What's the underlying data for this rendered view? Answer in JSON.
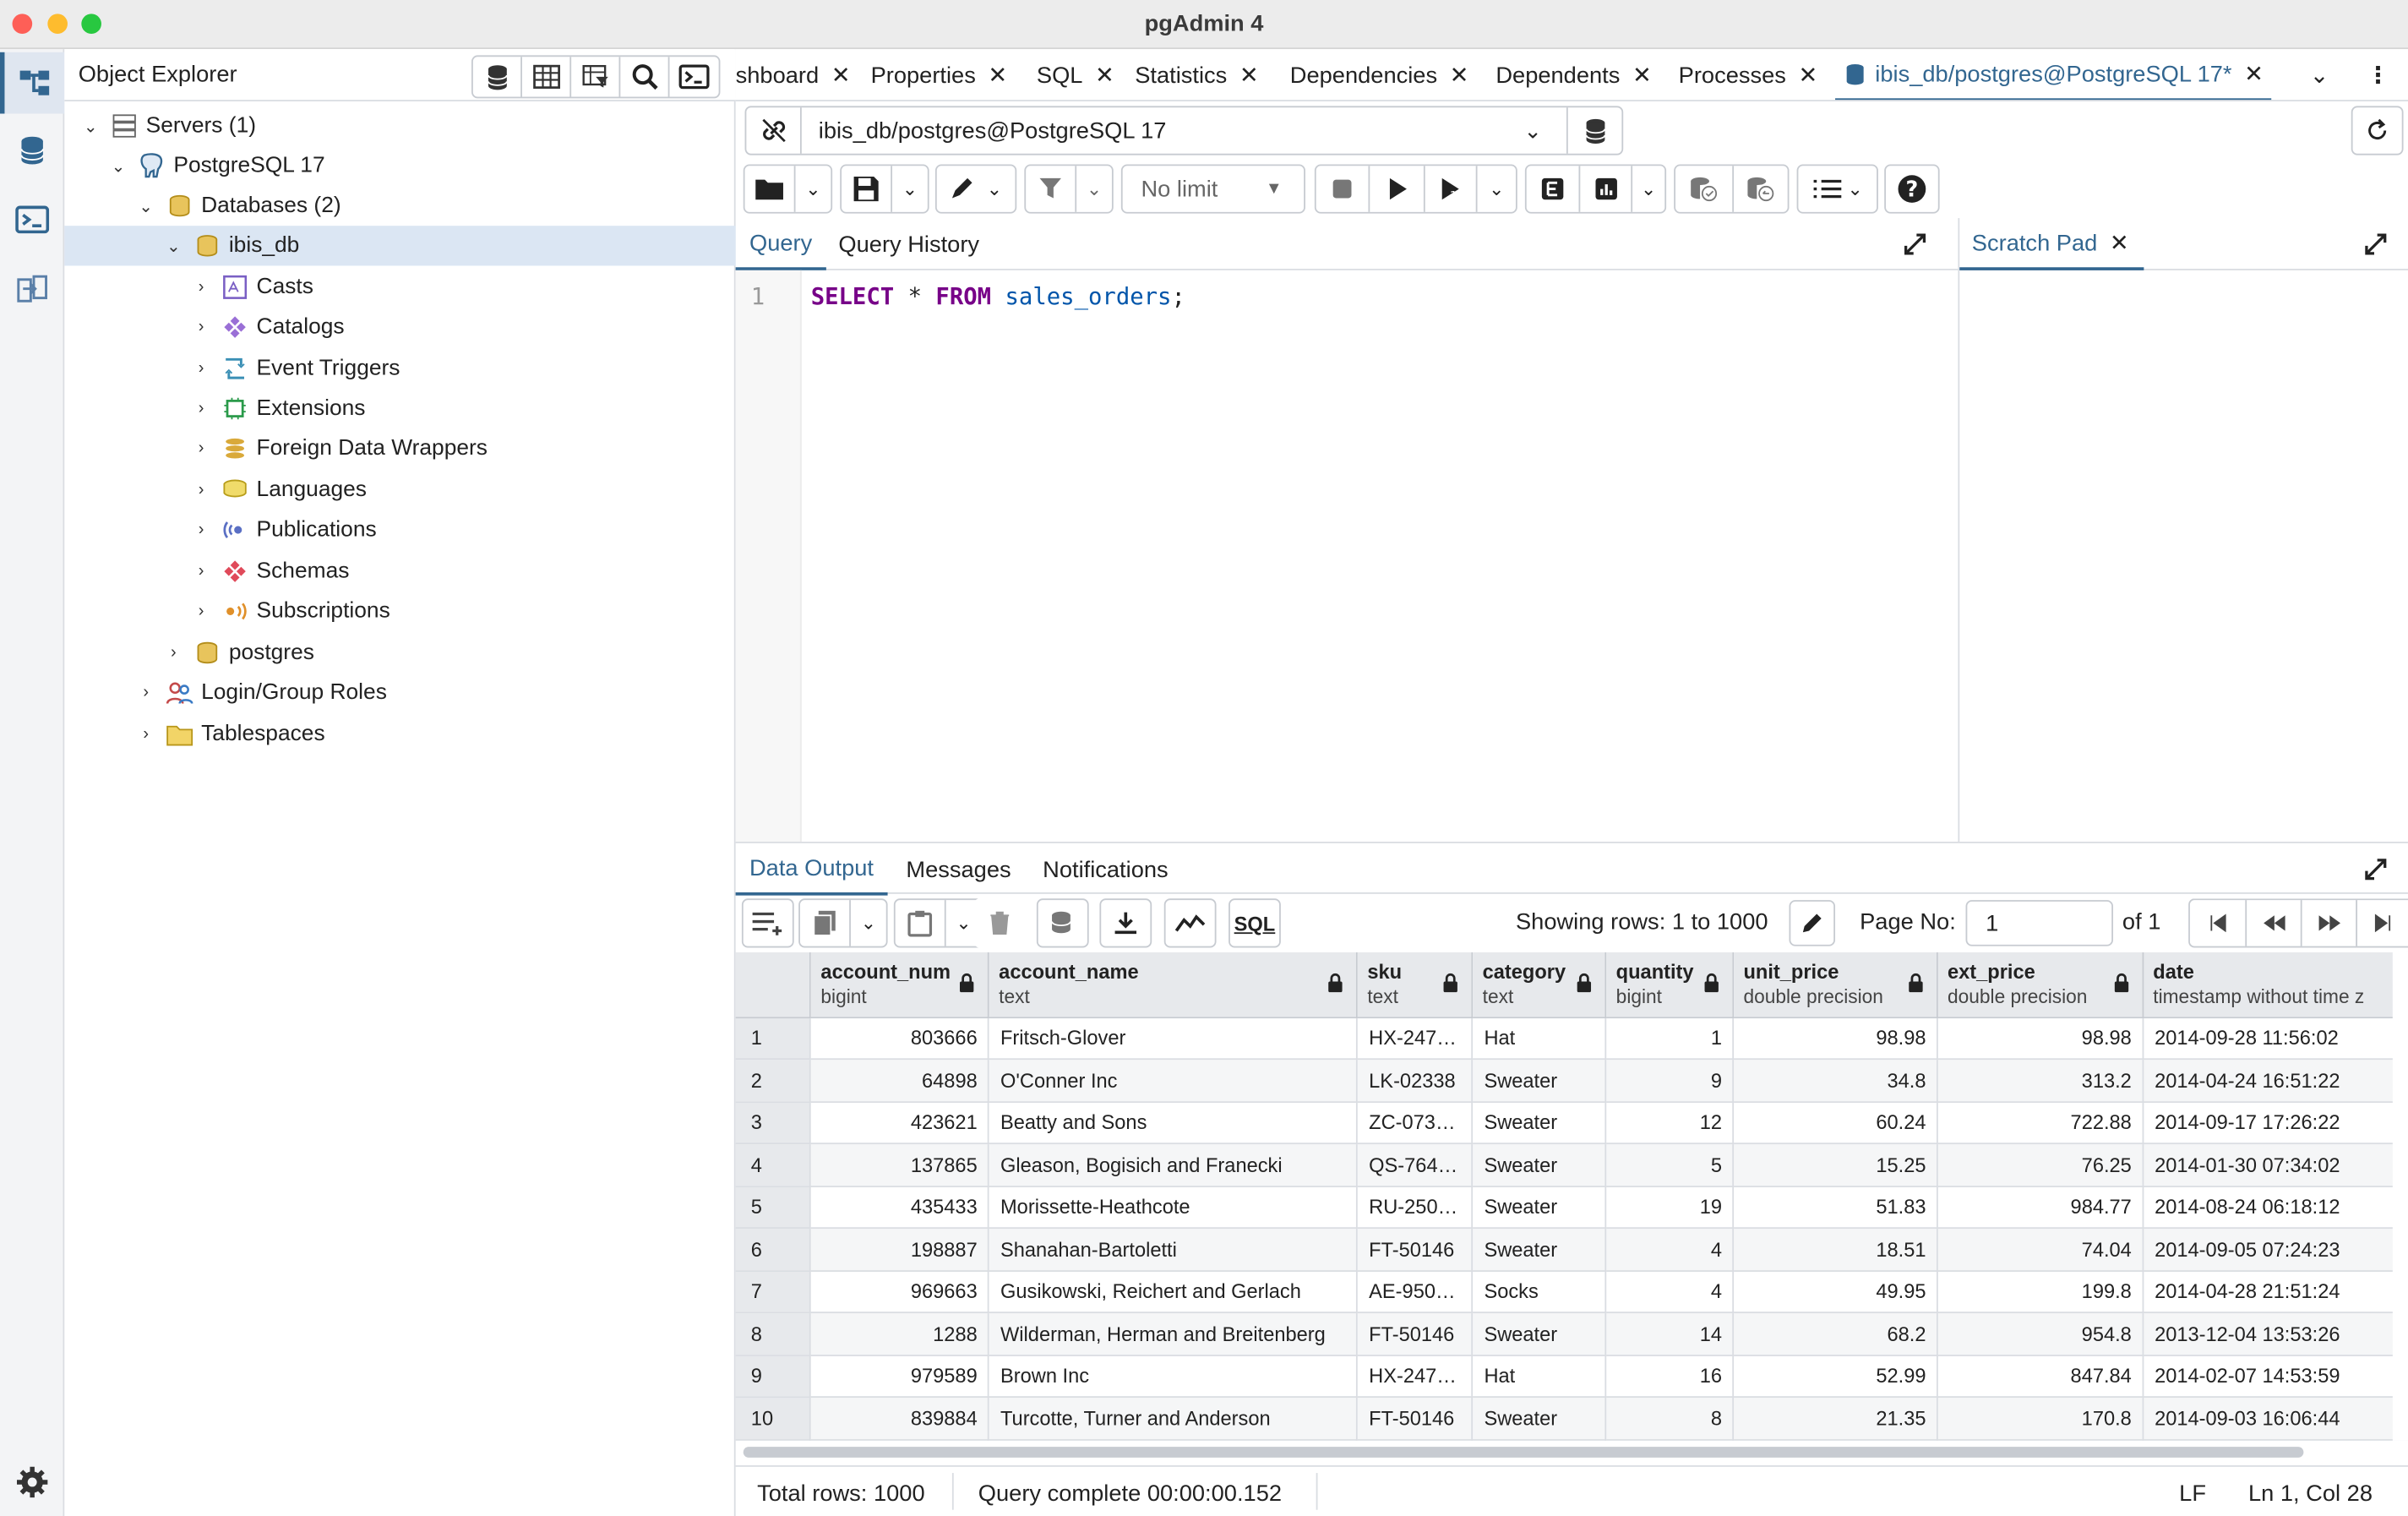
{
  "window": {
    "title": "pgAdmin 4"
  },
  "object_explorer": {
    "title": "Object Explorer",
    "tree": {
      "servers": "Servers (1)",
      "server": "PostgreSQL 17",
      "databases": "Databases (2)",
      "db": "ibis_db",
      "children": [
        "Casts",
        "Catalogs",
        "Event Triggers",
        "Extensions",
        "Foreign Data Wrappers",
        "Languages",
        "Publications",
        "Schemas",
        "Subscriptions"
      ],
      "postgres": "postgres",
      "roles": "Login/Group Roles",
      "tablespaces": "Tablespaces"
    }
  },
  "tabs": [
    "shboard",
    "Properties",
    "SQL",
    "Statistics",
    "Dependencies",
    "Dependents",
    "Processes",
    "ibis_db/postgres@PostgreSQL 17*"
  ],
  "connection": {
    "label": "ibis_db/postgres@PostgreSQL 17"
  },
  "toolbar": {
    "limit": "No limit"
  },
  "query_tabs": {
    "query": "Query",
    "history": "Query History",
    "scratch": "Scratch Pad"
  },
  "editor": {
    "line": "1",
    "kw1": "SELECT",
    "star": " * ",
    "kw2": "FROM",
    "table": " sales_orders",
    "semi": ";"
  },
  "result_tabs": {
    "data": "Data Output",
    "messages": "Messages",
    "notifications": "Notifications"
  },
  "pager": {
    "showing": "Showing rows: 1 to 1000",
    "page_label": "Page No:",
    "page": "1",
    "of": "of 1"
  },
  "grid": {
    "columns": [
      {
        "name": "account_num",
        "type": "bigint"
      },
      {
        "name": "account_name",
        "type": "text"
      },
      {
        "name": "sku",
        "type": "text"
      },
      {
        "name": "category",
        "type": "text"
      },
      {
        "name": "quantity",
        "type": "bigint"
      },
      {
        "name": "unit_price",
        "type": "double precision"
      },
      {
        "name": "ext_price",
        "type": "double precision"
      },
      {
        "name": "date",
        "type": "timestamp without time z"
      }
    ],
    "rows": [
      [
        "1",
        "803666",
        "Fritsch-Glover",
        "HX-247…",
        "Hat",
        "1",
        "98.98",
        "98.98",
        "2014-09-28 11:56:02"
      ],
      [
        "2",
        "64898",
        "O'Conner Inc",
        "LK-02338",
        "Sweater",
        "9",
        "34.8",
        "313.2",
        "2014-04-24 16:51:22"
      ],
      [
        "3",
        "423621",
        "Beatty and Sons",
        "ZC-073…",
        "Sweater",
        "12",
        "60.24",
        "722.88",
        "2014-09-17 17:26:22"
      ],
      [
        "4",
        "137865",
        "Gleason, Bogisich and Franecki",
        "QS-764…",
        "Sweater",
        "5",
        "15.25",
        "76.25",
        "2014-01-30 07:34:02"
      ],
      [
        "5",
        "435433",
        "Morissette-Heathcote",
        "RU-250…",
        "Sweater",
        "19",
        "51.83",
        "984.77",
        "2014-08-24 06:18:12"
      ],
      [
        "6",
        "198887",
        "Shanahan-Bartoletti",
        "FT-50146",
        "Sweater",
        "4",
        "18.51",
        "74.04",
        "2014-09-05 07:24:23"
      ],
      [
        "7",
        "969663",
        "Gusikowski, Reichert and Gerlach",
        "AE-950…",
        "Socks",
        "4",
        "49.95",
        "199.8",
        "2014-04-28 21:51:24"
      ],
      [
        "8",
        "1288",
        "Wilderman, Herman and Breitenberg",
        "FT-50146",
        "Sweater",
        "14",
        "68.2",
        "954.8",
        "2013-12-04 13:53:26"
      ],
      [
        "9",
        "979589",
        "Brown Inc",
        "HX-247…",
        "Hat",
        "16",
        "52.99",
        "847.84",
        "2014-02-07 14:53:59"
      ],
      [
        "10",
        "839884",
        "Turcotte, Turner and Anderson",
        "FT-50146",
        "Sweater",
        "8",
        "21.35",
        "170.8",
        "2014-09-03 16:06:44"
      ]
    ]
  },
  "status": {
    "total": "Total rows: 1000",
    "query": "Query complete 00:00:00.152",
    "eol": "LF",
    "pos": "Ln 1, Col 28"
  },
  "colors": {
    "accent": "#326690",
    "keyword": "#770088",
    "table": "#0055aa"
  }
}
